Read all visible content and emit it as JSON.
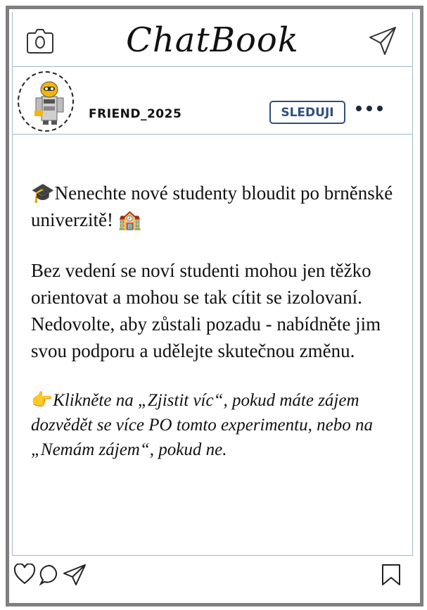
{
  "app": {
    "title": "ChatBook"
  },
  "header": {
    "camera_icon": "camera-icon",
    "send_icon": "send-icon"
  },
  "profile": {
    "username": "FRIEND_2025",
    "follow_label": "SLEDUJI",
    "avatar_icon": "robot-avatar",
    "more_icon": "more-options-icon"
  },
  "post": {
    "emoji1": "🎓",
    "line1": "Nenechte nové studenty bloudit po brněnské univerzitě!",
    "emoji2": "🏫",
    "paragraph2": "Bez vedení se noví studenti mohou jen těžko orientovat a mohou se tak cítit se izolovaní. Nedovolte, aby zůstali pozadu - nabídněte jim svou podporu a udělejte skutečnou změnu.",
    "emoji3": "👉",
    "paragraph3": "Klikněte na „Zjistit víc“, pokud máte zájem dozvědět se více PO tomto experimentu, nebo na „Nemám zájem“, pokud ne."
  },
  "actions": {
    "like_icon": "heart-icon",
    "comment_icon": "comment-icon",
    "share_icon": "send-icon",
    "save_icon": "bookmark-icon"
  }
}
